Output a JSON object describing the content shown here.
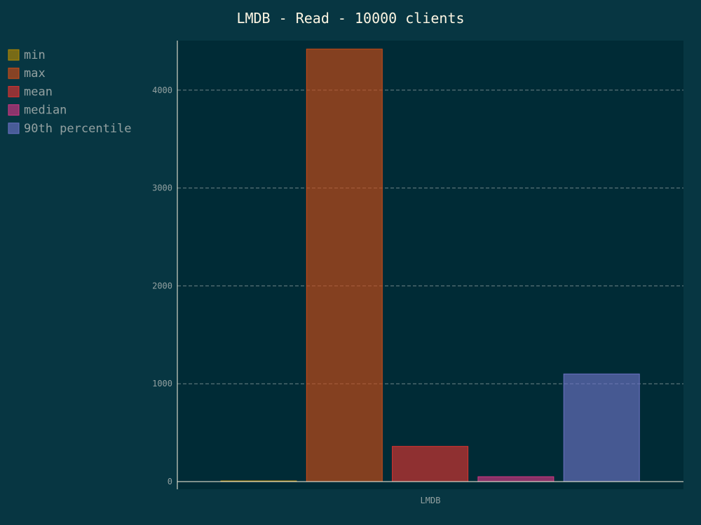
{
  "chart_data": {
    "type": "bar",
    "title": "LMDB - Read - 10000 clients",
    "categories": [
      "LMDB"
    ],
    "series": [
      {
        "name": "min",
        "values": [
          2
        ],
        "color": "#b58900"
      },
      {
        "name": "max",
        "values": [
          4420
        ],
        "color": "#cb4b16"
      },
      {
        "name": "mean",
        "values": [
          360
        ],
        "color": "#dc322f"
      },
      {
        "name": "median",
        "values": [
          50
        ],
        "color": "#d33682"
      },
      {
        "name": "90th percentile",
        "values": [
          1100
        ],
        "color": "#6c71c4"
      }
    ],
    "yticks": [
      0,
      1000,
      2000,
      3000,
      4000
    ],
    "ylim": [
      0,
      4500
    ],
    "grid": true,
    "legend_position": "left"
  },
  "colors": {
    "background": "#073642",
    "plot_background": "#002b36",
    "title": "#fdf6e3",
    "text": "#93a1a1",
    "grid": "#93a1a1"
  }
}
